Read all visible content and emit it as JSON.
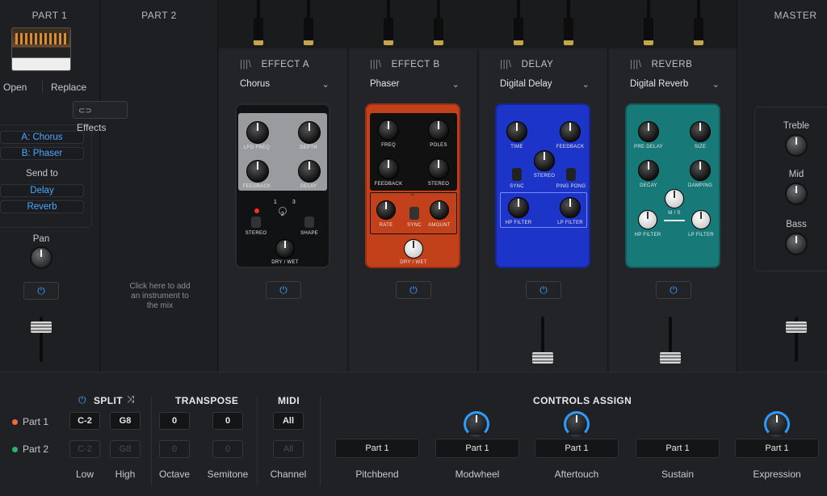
{
  "part1": {
    "title": "PART 1",
    "open": "Open",
    "replace": "Replace",
    "effects": "Effects",
    "slot_a": "A: Chorus",
    "slot_b": "B: Phaser",
    "send_to": "Send to",
    "send1": "Delay",
    "send2": "Reverb",
    "pan": "Pan"
  },
  "part2": {
    "title": "PART 2",
    "hint": "Click here to add an instrument to the mix"
  },
  "master": {
    "title": "MASTER",
    "treble": "Treble",
    "mid": "Mid",
    "bass": "Bass"
  },
  "effects": [
    {
      "label": "EFFECT A",
      "preset": "Chorus",
      "knobs": [
        "LFO FREQ",
        "DEPTH",
        "FEEDBACK",
        "DELAY"
      ],
      "extra": [
        "STEREO",
        "SHAPE",
        "DRY / WET"
      ],
      "switch": [
        "1",
        "2",
        "3"
      ]
    },
    {
      "label": "EFFECT B",
      "preset": "Phaser",
      "knobs": [
        "FREQ",
        "POLES",
        "FEEDBACK",
        "STEREO"
      ],
      "extra": [
        "RATE",
        "SYNC",
        "AMOUNT",
        "DRY / WET"
      ]
    },
    {
      "label": "DELAY",
      "preset": "Digital Delay",
      "knobs": [
        "TIME",
        "FEEDBACK",
        "STEREO",
        "SYNC",
        "PING PONG",
        "HP FILTER",
        "LP FILTER"
      ]
    },
    {
      "label": "REVERB",
      "preset": "Digital Reverb",
      "knobs": [
        "PRE DELAY",
        "SIZE",
        "DECAY",
        "DAMPING",
        "M / S",
        "HP FILTER",
        "LP FILTER"
      ]
    }
  ],
  "colors": {
    "accent": "#3a9eff",
    "chorus": "#111214",
    "phaser": "#c2401a",
    "delay": "#1d34c8",
    "reverb": "#187a78",
    "part1_dot": "#f06a3c",
    "part2_dot": "#2fb36a"
  },
  "bottom": {
    "split": "SPLIT",
    "transpose": "TRANSPOSE",
    "midi": "MIDI",
    "controls": "CONTROLS ASSIGN",
    "part1": "Part 1",
    "part2": "Part 2",
    "p1": {
      "low": "C-2",
      "high": "G8",
      "octave": "0",
      "semitone": "0",
      "channel": "All"
    },
    "p2": {
      "low": "C-2",
      "high": "G8",
      "octave": "0",
      "semitone": "0",
      "channel": "All"
    },
    "labels": {
      "low": "Low",
      "high": "High",
      "octave": "Octave",
      "semitone": "Semitone",
      "channel": "Channel"
    },
    "assign": [
      {
        "target": "Part 1",
        "name": "Pitchbend"
      },
      {
        "target": "Part 1",
        "name": "Modwheel"
      },
      {
        "target": "Part 1",
        "name": "Aftertouch"
      },
      {
        "target": "Part 1",
        "name": "Sustain"
      },
      {
        "target": "Part 1",
        "name": "Expression"
      }
    ]
  }
}
